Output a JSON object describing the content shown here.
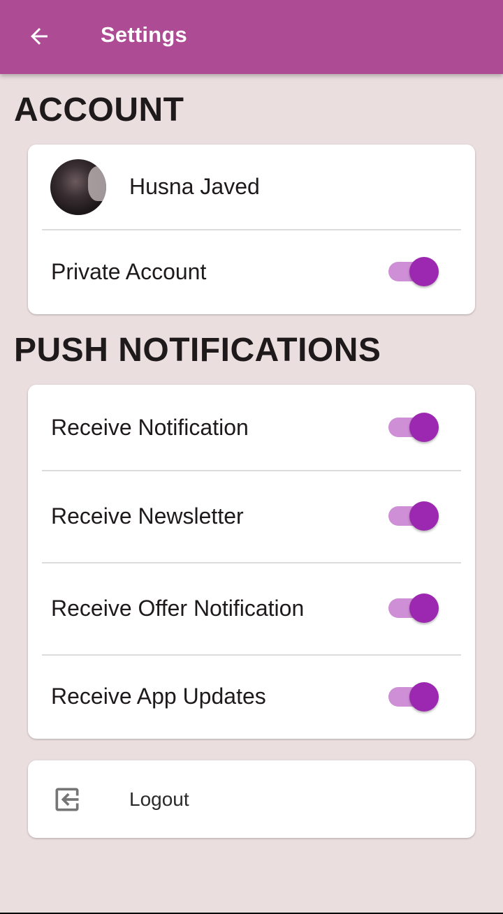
{
  "colors": {
    "appbar": "#ad4c94",
    "background": "#ebdede",
    "switch_thumb": "#9c27b0",
    "switch_track": "#cf8fd6"
  },
  "appbar": {
    "title": "Settings",
    "back_icon": "arrow-left-icon"
  },
  "account": {
    "heading": "ACCOUNT",
    "profile_name": "Husna Javed",
    "private_account": {
      "label": "Private Account",
      "enabled": true
    }
  },
  "push": {
    "heading": "PUSH NOTIFICATIONS",
    "items": [
      {
        "label": "Receive Notification",
        "enabled": true
      },
      {
        "label": "Receive Newsletter",
        "enabled": true
      },
      {
        "label": "Receive Offer Notification",
        "enabled": true
      },
      {
        "label": "Receive App Updates",
        "enabled": true
      }
    ]
  },
  "logout": {
    "label": "Logout",
    "icon": "logout-icon"
  }
}
